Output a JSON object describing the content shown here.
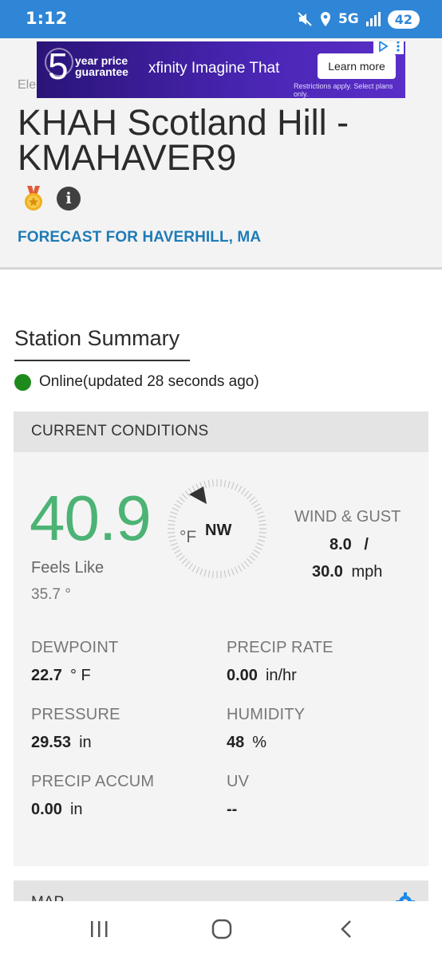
{
  "status_bar": {
    "time": "1:12",
    "network": "5G",
    "battery": "42",
    "accent_color": "#2f86d6"
  },
  "ad": {
    "big_number": "5",
    "tagline_line1": "year price",
    "tagline_line2": "guarantee",
    "brand": "xfinity Imagine That",
    "button": "Learn more",
    "fine_print": "Restrictions apply. Select plans only."
  },
  "background_crumb": "Ele",
  "station": {
    "title": "KHAH Scotland Hill - KMAHAVER9",
    "forecast_link": "FORECAST FOR HAVERHILL, MA",
    "icons": [
      "medal-icon",
      "info-icon"
    ]
  },
  "summary": {
    "title": "Station Summary",
    "status": "Online(updated 28 seconds ago)",
    "status_color": "#1e8a1e"
  },
  "conditions": {
    "header": "CURRENT CONDITIONS",
    "temperature": "40.9",
    "temperature_color": "#4cb375",
    "feels_like_label": "Feels Like",
    "feels_like_value": "35.7 °",
    "unit": "°F",
    "wind_direction": "NW",
    "wind_label": "WIND & GUST",
    "wind_speed": "8.0",
    "wind_separator": "/",
    "gust_speed": "30.0",
    "wind_unit": "mph",
    "metrics": [
      {
        "label": "DEWPOINT",
        "value": "22.7",
        "unit": "° F"
      },
      {
        "label": "PRECIP RATE",
        "value": "0.00",
        "unit": "in/hr"
      },
      {
        "label": "PRESSURE",
        "value": "29.53",
        "unit": "in"
      },
      {
        "label": "HUMIDITY",
        "value": "48",
        "unit": "%"
      },
      {
        "label": "PRECIP ACCUM",
        "value": "0.00",
        "unit": "in"
      },
      {
        "label": "UV",
        "value": "--",
        "unit": ""
      }
    ]
  },
  "map": {
    "label": "MAP"
  },
  "nav": {
    "icons": [
      "recent-apps-icon",
      "home-icon",
      "back-icon"
    ]
  }
}
